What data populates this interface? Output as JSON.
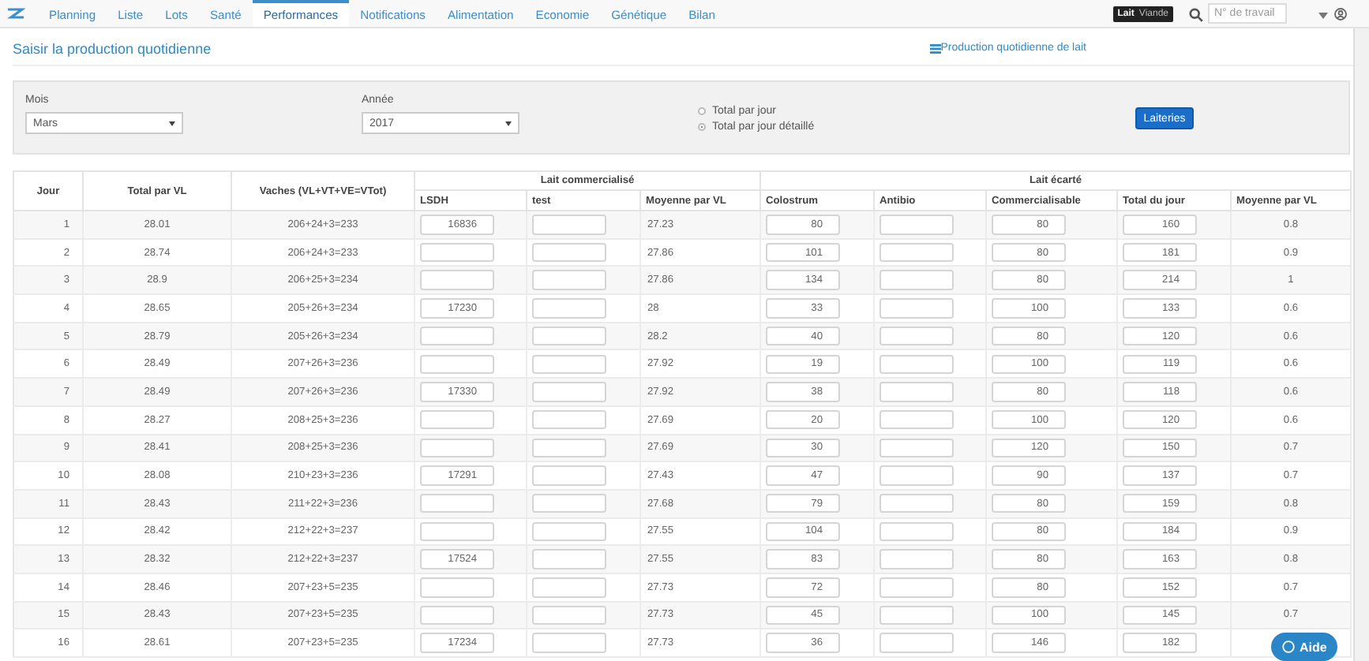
{
  "nav": {
    "tabs": [
      {
        "label": "Planning",
        "selected": false
      },
      {
        "label": "Liste",
        "selected": false
      },
      {
        "label": "Lots",
        "selected": false
      },
      {
        "label": "Santé",
        "selected": false
      },
      {
        "label": "Performances",
        "selected": true
      },
      {
        "label": "Notifications",
        "selected": false
      },
      {
        "label": "Alimentation",
        "selected": false
      },
      {
        "label": "Economie",
        "selected": false
      },
      {
        "label": "Génétique",
        "selected": false
      },
      {
        "label": "Bilan",
        "selected": false
      }
    ],
    "toggle": [
      {
        "label": "Lait",
        "selected": true
      },
      {
        "label": "Viande",
        "selected": false
      }
    ],
    "search": {
      "placeholder": "N° de travail"
    }
  },
  "page": {
    "title": "Saisir la production quotidienne",
    "link": "Production quotidienne de lait"
  },
  "filters": {
    "month": {
      "label": "Mois",
      "value": "Mars"
    },
    "year": {
      "label": "Année",
      "value": "2017"
    },
    "display_options": [
      {
        "label": "Total par jour",
        "selected": false
      },
      {
        "label": "Total par jour détaillé",
        "selected": true
      }
    ],
    "button": "Laiteries"
  },
  "table": {
    "column_groups": [
      {
        "label": "Lait commercialisé",
        "colspan": 3
      },
      {
        "label": "Lait écarté",
        "colspan": 5
      }
    ],
    "columns": [
      {
        "label": "Jour",
        "kind": "number",
        "grouped": false
      },
      {
        "label": "Total par VL",
        "kind": "text",
        "grouped": false
      },
      {
        "label": "Vaches (VL+VT+VE=VTot)",
        "kind": "text",
        "grouped": false
      },
      {
        "label": "LSDH",
        "kind": "input",
        "grouped": true
      },
      {
        "label": "test",
        "kind": "input",
        "grouped": true
      },
      {
        "label": "Moyenne par VL",
        "kind": "left",
        "grouped": true
      },
      {
        "label": "Colostrum",
        "kind": "input",
        "grouped": true
      },
      {
        "label": "Antibio",
        "kind": "input",
        "grouped": true
      },
      {
        "label": "Commercialisable",
        "kind": "input",
        "grouped": true
      },
      {
        "label": "Total du jour",
        "kind": "input",
        "grouped": true
      },
      {
        "label": "Moyenne par VL",
        "kind": "text",
        "grouped": true
      }
    ],
    "rows": [
      [
        "1",
        "28.01",
        "206+24+3=233",
        "16836",
        null,
        "27.23",
        "80",
        null,
        "80",
        "160",
        "0.8"
      ],
      [
        "2",
        "28.74",
        "206+24+3=233",
        null,
        null,
        "27.86",
        "101",
        null,
        "80",
        "181",
        "0.9"
      ],
      [
        "3",
        "28.9",
        "206+25+3=234",
        null,
        null,
        "27.86",
        "134",
        null,
        "80",
        "214",
        "1"
      ],
      [
        "4",
        "28.65",
        "205+26+3=234",
        "17230",
        null,
        "28",
        "33",
        null,
        "100",
        "133",
        "0.6"
      ],
      [
        "5",
        "28.79",
        "205+26+3=234",
        null,
        null,
        "28.2",
        "40",
        null,
        "80",
        "120",
        "0.6"
      ],
      [
        "6",
        "28.49",
        "207+26+3=236",
        null,
        null,
        "27.92",
        "19",
        null,
        "100",
        "119",
        "0.6"
      ],
      [
        "7",
        "28.49",
        "207+26+3=236",
        "17330",
        null,
        "27.92",
        "38",
        null,
        "80",
        "118",
        "0.6"
      ],
      [
        "8",
        "28.27",
        "208+25+3=236",
        null,
        null,
        "27.69",
        "20",
        null,
        "100",
        "120",
        "0.6"
      ],
      [
        "9",
        "28.41",
        "208+25+3=236",
        null,
        null,
        "27.69",
        "30",
        null,
        "120",
        "150",
        "0.7"
      ],
      [
        "10",
        "28.08",
        "210+23+3=236",
        "17291",
        null,
        "27.43",
        "47",
        null,
        "90",
        "137",
        "0.7"
      ],
      [
        "11",
        "28.43",
        "211+22+3=236",
        null,
        null,
        "27.68",
        "79",
        null,
        "80",
        "159",
        "0.8"
      ],
      [
        "12",
        "28.42",
        "212+22+3=237",
        null,
        null,
        "27.55",
        "104",
        null,
        "80",
        "184",
        "0.9"
      ],
      [
        "13",
        "28.32",
        "212+22+3=237",
        "17524",
        null,
        "27.55",
        "83",
        null,
        "80",
        "163",
        "0.8"
      ],
      [
        "14",
        "28.46",
        "207+23+5=235",
        null,
        null,
        "27.73",
        "72",
        null,
        "80",
        "152",
        "0.7"
      ],
      [
        "15",
        "28.43",
        "207+23+5=235",
        null,
        null,
        "27.73",
        "45",
        null,
        "100",
        "145",
        "0.7"
      ],
      [
        "16",
        "28.61",
        "207+23+5=235",
        "17234",
        null,
        "27.73",
        "36",
        null,
        "146",
        "182",
        null
      ]
    ]
  },
  "help_button": "Aide"
}
